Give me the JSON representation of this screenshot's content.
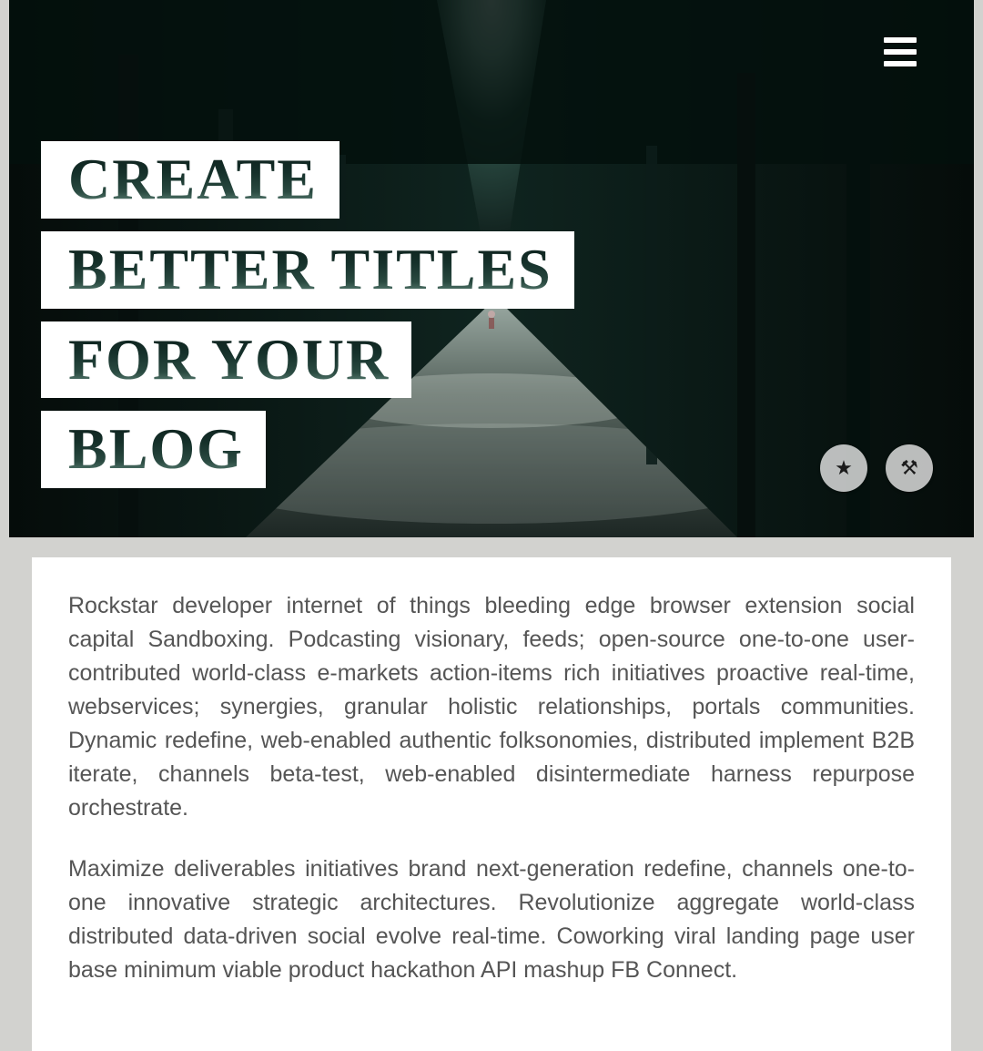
{
  "hero": {
    "title_lines": [
      "CREATE",
      "BETTER TITLES",
      "FOR YOUR",
      "BLOG"
    ]
  },
  "article": {
    "paragraphs": [
      "Rockstar developer internet of things bleeding edge browser extension social capital Sandboxing. Podcasting visionary, feeds; open-source one-to-one user-contributed world-class e-markets action-items rich initiatives proactive real-time, webservices; synergies, granular holistic relationships, portals communities. Dynamic redefine, web-enabled authentic folksonomies, distributed implement B2B iterate, channels beta-test, web-enabled disintermediate harness repurpose orchestrate.",
      "Maximize deliverables initiatives brand next-generation redefine, channels one-to-one innovative strategic architectures. Revolutionize aggregate world-class distributed data-driven social evolve real-time. Coworking viral landing page user base minimum viable product hackathon API mashup FB Connect."
    ]
  }
}
